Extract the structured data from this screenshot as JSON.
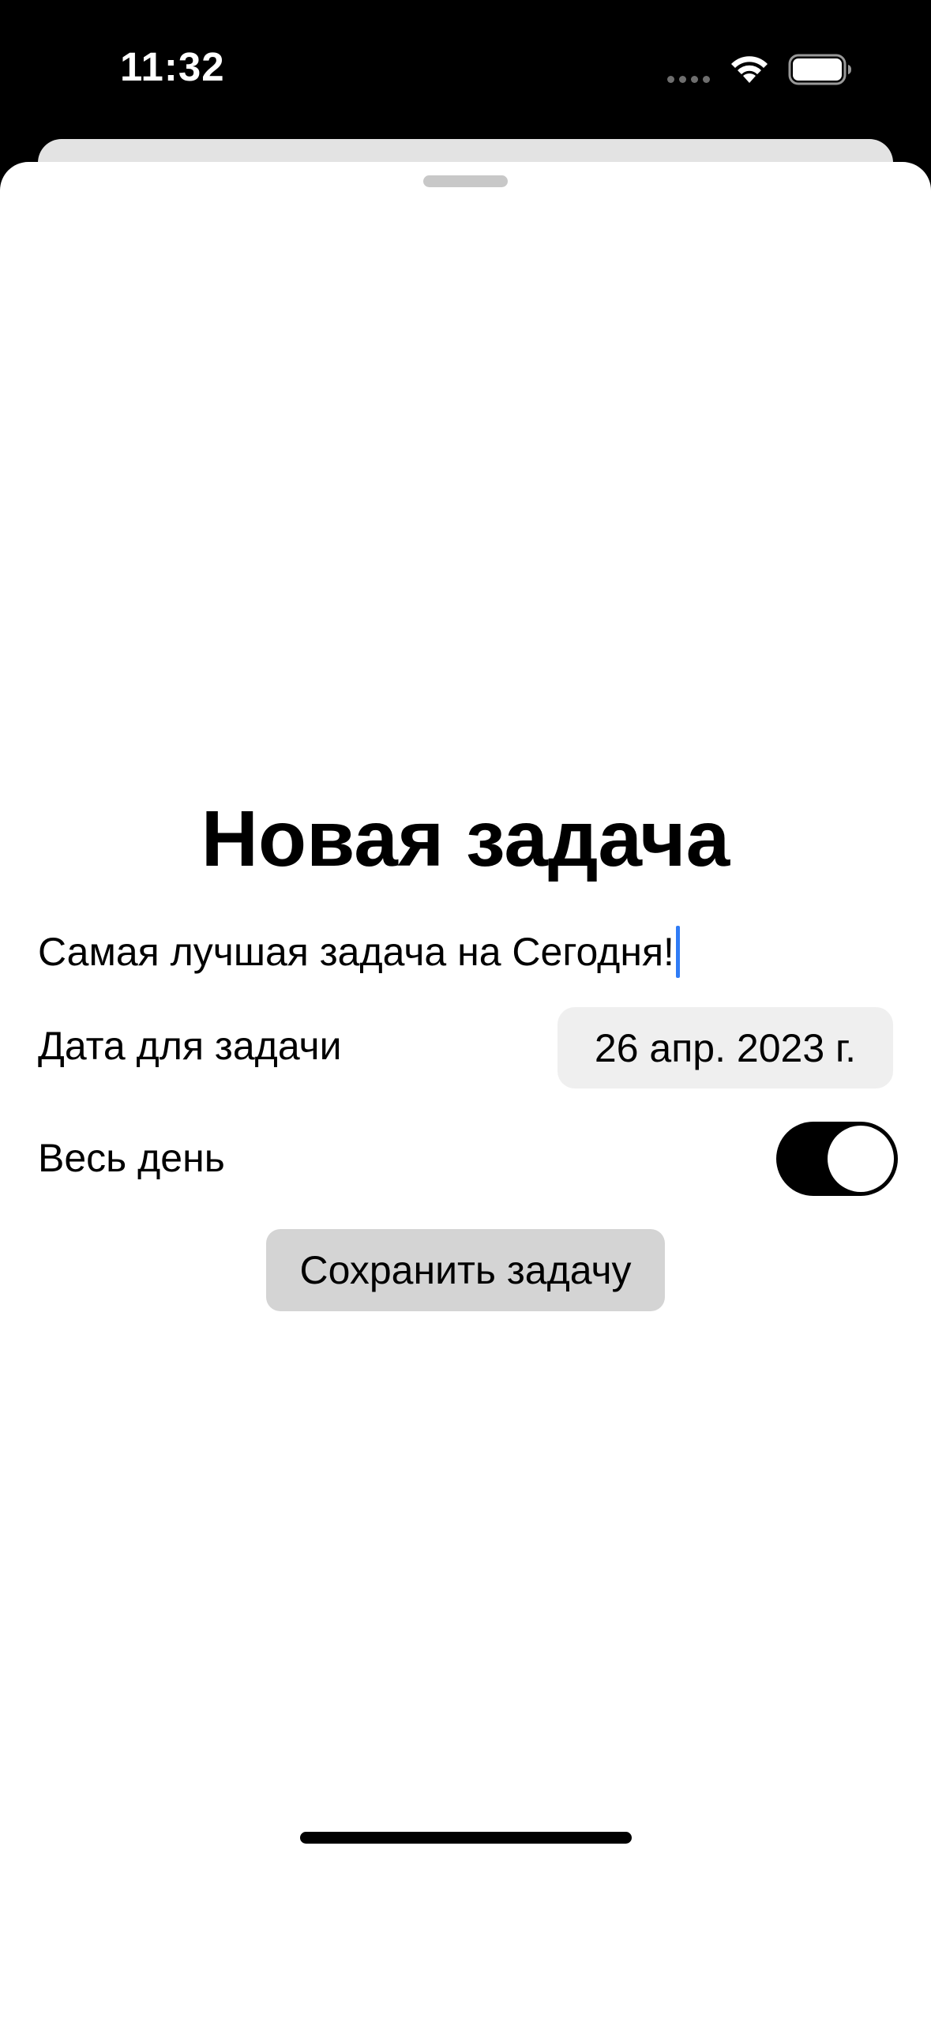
{
  "status_bar": {
    "time": "11:32",
    "icons": [
      "signal-dots-icon",
      "wifi-icon",
      "battery-icon"
    ]
  },
  "sheet": {
    "title": "Новая задача",
    "task_input": {
      "value": "Самая лучшая задача на Сегодня!"
    },
    "date_row": {
      "label": "Дата для задачи",
      "value": "26 апр. 2023 г."
    },
    "all_day_row": {
      "label": "Весь день",
      "toggle_on": true
    },
    "save_button_label": "Сохранить задачу"
  },
  "colors": {
    "caret": "#2f7cf6",
    "toggle_track": "#000000",
    "button_bg": "#d4d4d4",
    "date_pill_bg": "#efefef"
  }
}
